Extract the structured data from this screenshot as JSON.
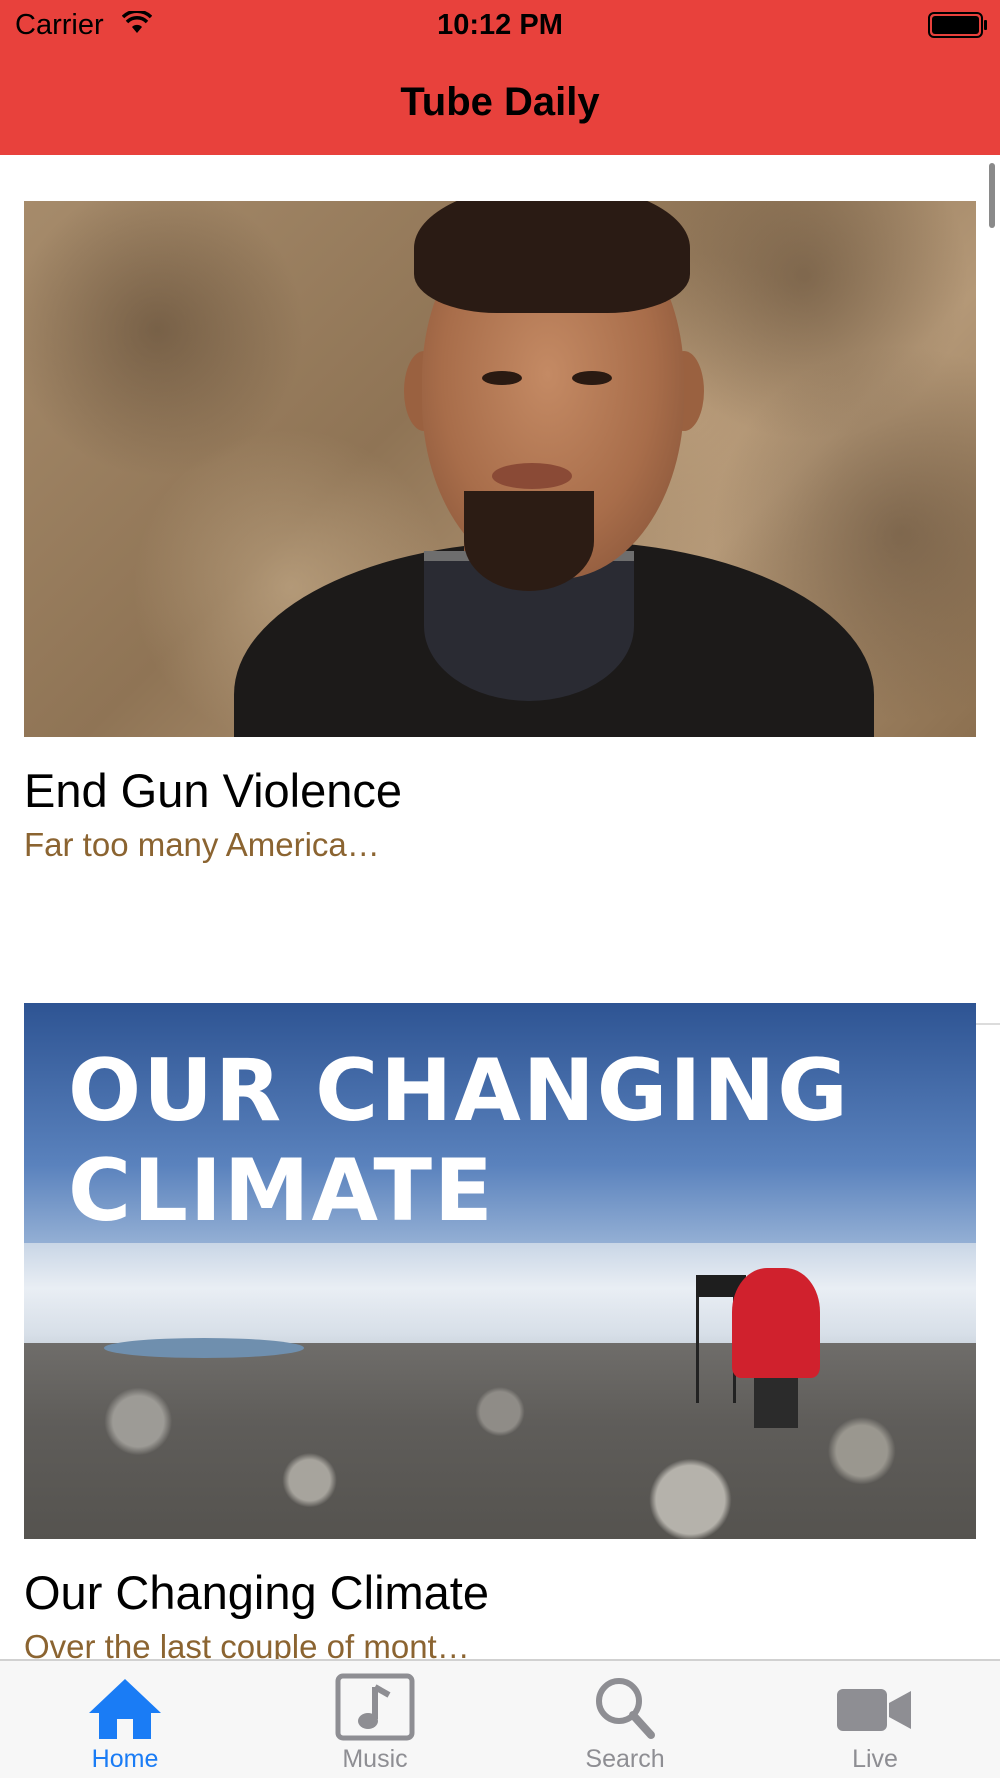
{
  "status_bar": {
    "carrier": "Carrier",
    "time": "10:12 PM"
  },
  "nav": {
    "title": "Tube Daily",
    "color": "#e8413c"
  },
  "videos": [
    {
      "title": "End Gun Violence",
      "description": "Far too many America…",
      "thumbnail": "portrait-photo"
    },
    {
      "title": "Our Changing Climate",
      "description": "Over the last couple of mont…",
      "thumbnail": "glacier-photo",
      "thumbnail_text": "OUR CHANGING\nCLIMATE"
    }
  ],
  "tabs": [
    {
      "label": "Home",
      "icon": "home-icon",
      "active": true
    },
    {
      "label": "Music",
      "icon": "music-note-icon",
      "active": false
    },
    {
      "label": "Search",
      "icon": "search-icon",
      "active": false
    },
    {
      "label": "Live",
      "icon": "video-camera-icon",
      "active": false
    }
  ],
  "colors": {
    "accent": "#1a7cf5",
    "inactive_tab": "#8e8e93",
    "description": "#8b6431"
  }
}
